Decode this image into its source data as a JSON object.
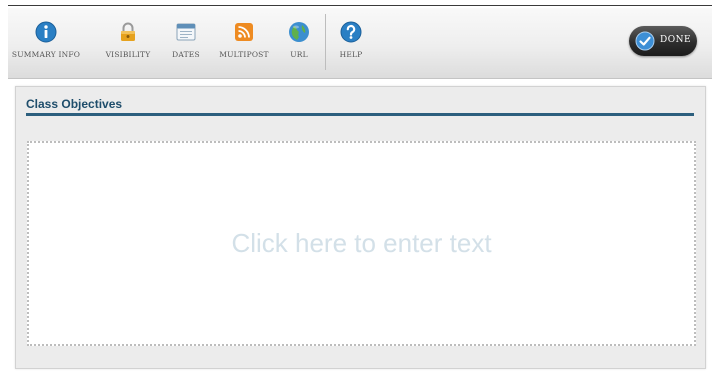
{
  "toolbar": {
    "items": [
      {
        "id": "summary-info",
        "label": "SUMMARY INFO",
        "icon": "info-icon"
      },
      {
        "id": "visibility",
        "label": "VISIBILITY",
        "icon": "lock-icon"
      },
      {
        "id": "dates",
        "label": "DATES",
        "icon": "calendar-icon"
      },
      {
        "id": "multipost",
        "label": "MULTIPOST",
        "icon": "rss-icon"
      },
      {
        "id": "url",
        "label": "URL",
        "icon": "globe-icon"
      },
      {
        "id": "help",
        "label": "HELP",
        "icon": "help-icon"
      }
    ],
    "done_label": "DONE"
  },
  "panel": {
    "title": "Class Objectives",
    "editor_placeholder": "Click here to enter text"
  },
  "colors": {
    "title": "#1e4d6b",
    "title_rule": "#2c5f7e",
    "info": "#2a7fc4",
    "lock": "#e6a21e",
    "rss": "#ee8b22",
    "globe": "#3c8fcf",
    "help": "#2a7fc4",
    "done_button": "#2e2e2e",
    "placeholder": "#d3e0e8"
  }
}
